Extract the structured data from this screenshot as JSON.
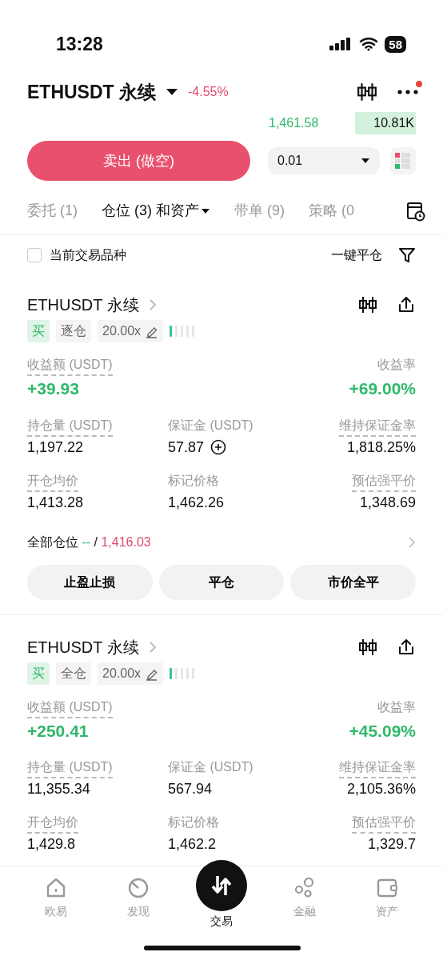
{
  "status_bar": {
    "time": "13:28",
    "battery": "58"
  },
  "header": {
    "symbol": "ETHUSDT 永续",
    "change": "-4.55%",
    "notification": true
  },
  "order": {
    "price": "1,461.58",
    "depth": "10.81K",
    "sell_button": "卖出 (做空)",
    "quantity": "0.01"
  },
  "tabs": [
    {
      "label": "委托 (1)",
      "selected": false,
      "dropdown": false
    },
    {
      "label": "仓位 (3) 和资产",
      "selected": true,
      "dropdown": true
    },
    {
      "label": "带单 (9)",
      "selected": false,
      "dropdown": false
    },
    {
      "label": "策略 (0",
      "selected": false,
      "dropdown": false
    }
  ],
  "filter": {
    "label": "当前交易品种",
    "checked": false,
    "close_all": "一键平仓"
  },
  "positions": [
    {
      "title": "ETHUSDT 永续",
      "side": "买",
      "margin_mode": "逐仓",
      "leverage": "20.00x",
      "level": 0.2,
      "pnl_label": "收益额 (USDT)",
      "pnl": "+39.93",
      "roi_label": "收益率",
      "roi": "+69.00%",
      "metrics": [
        {
          "label": "持仓量 (USDT)",
          "value": "1,197.22",
          "dashed": true,
          "add": false
        },
        {
          "label": "保证金 (USDT)",
          "value": "57.87",
          "dashed": false,
          "add": true
        },
        {
          "label": "维持保证金率",
          "value": "1,818.25%",
          "dashed": true,
          "add": false
        },
        {
          "label": "开仓均价",
          "value": "1,413.28",
          "dashed": true,
          "add": false
        },
        {
          "label": "标记价格",
          "value": "1,462.26",
          "dashed": false,
          "add": false
        },
        {
          "label": "预估强平价",
          "value": "1,348.69",
          "dashed": true,
          "add": false
        }
      ],
      "total": {
        "label": "全部仓位",
        "long": "--",
        "separator": "/",
        "short": "1,416.03"
      },
      "buttons": [
        "止盈止损",
        "平仓",
        "市价全平"
      ]
    },
    {
      "title": "ETHUSDT 永续",
      "side": "买",
      "margin_mode": "全仓",
      "leverage": "20.00x",
      "level": 0.2,
      "pnl_label": "收益额 (USDT)",
      "pnl": "+250.41",
      "roi_label": "收益率",
      "roi": "+45.09%",
      "metrics": [
        {
          "label": "持仓量 (USDT)",
          "value": "11,355.34",
          "dashed": true,
          "add": false
        },
        {
          "label": "保证金 (USDT)",
          "value": "567.94",
          "dashed": false,
          "add": false
        },
        {
          "label": "维持保证金率",
          "value": "2,105.36%",
          "dashed": true,
          "add": false
        },
        {
          "label": "开仓均价",
          "value": "1,429.8",
          "dashed": true,
          "add": false
        },
        {
          "label": "标记价格",
          "value": "1,462.2",
          "dashed": false,
          "add": false
        },
        {
          "label": "预估强平价",
          "value": "1,329.7",
          "dashed": true,
          "add": false
        }
      ]
    }
  ],
  "bottom_nav": [
    {
      "label": "欧易",
      "kind": "home",
      "selected": false
    },
    {
      "label": "发现",
      "kind": "discover",
      "selected": false
    },
    {
      "label": "交易",
      "kind": "trade",
      "selected": true
    },
    {
      "label": "金融",
      "kind": "finance",
      "selected": false
    },
    {
      "label": "资产",
      "kind": "assets",
      "selected": false
    }
  ]
}
